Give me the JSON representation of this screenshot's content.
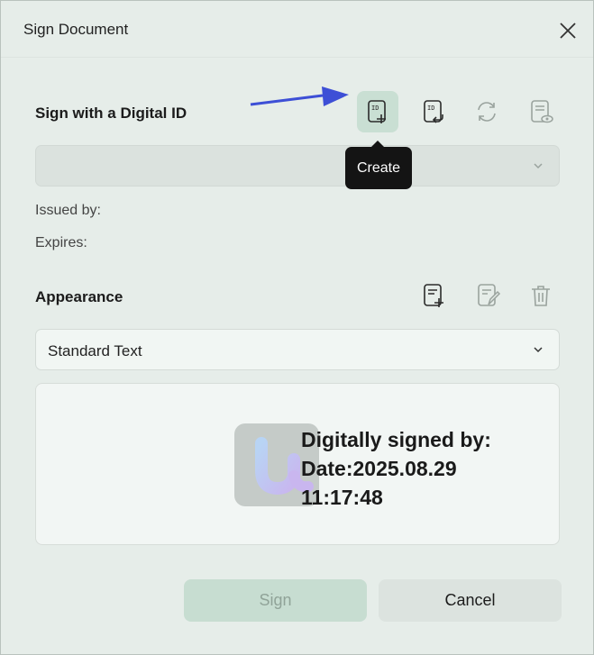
{
  "dialog": {
    "title": "Sign Document"
  },
  "digital_id": {
    "label": "Sign with a Digital ID",
    "selected": "",
    "issued_by_label": "Issued by:",
    "expires_label": "Expires:",
    "tooltip": "Create",
    "tools": [
      "create-id-icon",
      "import-id-icon",
      "refresh-icon",
      "view-id-icon"
    ]
  },
  "appearance": {
    "label": "Appearance",
    "selected": "Standard Text",
    "tools": [
      "add-appearance-icon",
      "edit-appearance-icon",
      "delete-icon"
    ],
    "preview": {
      "line1": "Digitally signed by:",
      "line2": "Date:2025.08.29",
      "line3": "11:17:48"
    }
  },
  "buttons": {
    "sign": "Sign",
    "cancel": "Cancel"
  },
  "colors": {
    "accent": "#c9dfd3",
    "arrow": "#3d4fd6",
    "tooltip_bg": "#141414"
  }
}
